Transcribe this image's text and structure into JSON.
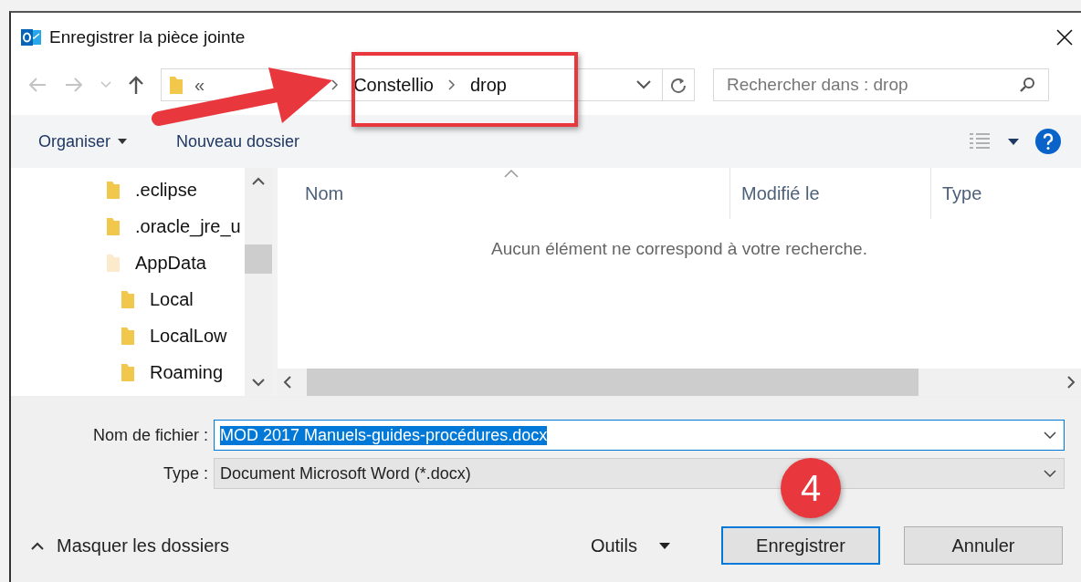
{
  "window": {
    "title": "Enregistrer la pièce jointe"
  },
  "address_bar": {
    "overflow": "«",
    "crumbs": [
      "Constellio",
      "drop"
    ]
  },
  "search": {
    "placeholder": "Rechercher dans : drop"
  },
  "toolbar": {
    "organize": "Organiser",
    "new_folder": "Nouveau dossier"
  },
  "nav_tree": [
    {
      "label": ".eclipse",
      "hidden": false
    },
    {
      "label": ".oracle_jre_u",
      "hidden": false
    },
    {
      "label": "AppData",
      "hidden": true,
      "children": [
        {
          "label": "Local",
          "hidden": false
        },
        {
          "label": "LocalLow",
          "hidden": false
        },
        {
          "label": "Roaming",
          "hidden": false
        }
      ]
    }
  ],
  "columns": [
    {
      "label": "Nom",
      "sorted": true
    },
    {
      "label": "Modifié le",
      "sorted": false
    },
    {
      "label": "Type",
      "sorted": false
    }
  ],
  "empty_message": "Aucun élément ne correspond à votre recherche.",
  "form": {
    "filename_label": "Nom de fichier :",
    "filename": "MOD 2017 Manuels-guides-procédures.docx",
    "type_label": "Type :",
    "type": "Document Microsoft Word (*.docx)"
  },
  "footer": {
    "hide_folders": "Masquer les dossiers",
    "tools": "Outils",
    "buttons": [
      {
        "label": "Enregistrer",
        "default": true
      },
      {
        "label": "Annuler",
        "default": false
      }
    ]
  },
  "annotations": {
    "step_badge": "4"
  }
}
